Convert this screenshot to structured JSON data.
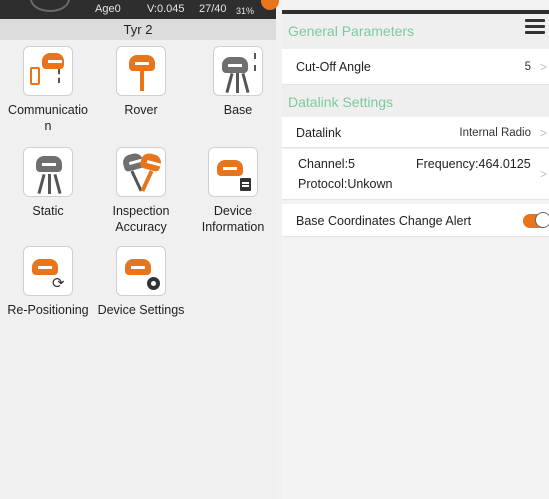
{
  "statusbar": {
    "age": "Age0",
    "v": "V:0.045",
    "sats": "27/40",
    "battery": "31%"
  },
  "device": {
    "name": "Tyr 2"
  },
  "tiles": [
    {
      "label": "Communicatio\nn",
      "icon": "communication-icon"
    },
    {
      "label": "Rover",
      "icon": "rover-icon"
    },
    {
      "label": "Base",
      "icon": "base-icon"
    },
    {
      "label": "Static",
      "icon": "static-icon"
    },
    {
      "label": "Inspection Accuracy",
      "icon": "inspection-accuracy-icon"
    },
    {
      "label": "Device Information",
      "icon": "device-information-icon"
    },
    {
      "label": "Re-Positioning",
      "icon": "re-positioning-icon"
    },
    {
      "label": "Device Settings",
      "icon": "device-settings-icon"
    }
  ],
  "right": {
    "general_title": "General Parameters",
    "cutoff_label": "Cut-Off Angle",
    "cutoff_value": "5",
    "datalink_title": "Datalink Settings",
    "datalink_label": "Datalink",
    "datalink_value": "Internal Radio",
    "channel": "Channel:5",
    "frequency": "Frequency:464.0125",
    "protocol": "Protocol:Unkown",
    "alert_label": "Base Coordinates Change Alert",
    "alert_on": true
  },
  "colors": {
    "accent": "#e8751c",
    "section": "#7dc9a0"
  }
}
